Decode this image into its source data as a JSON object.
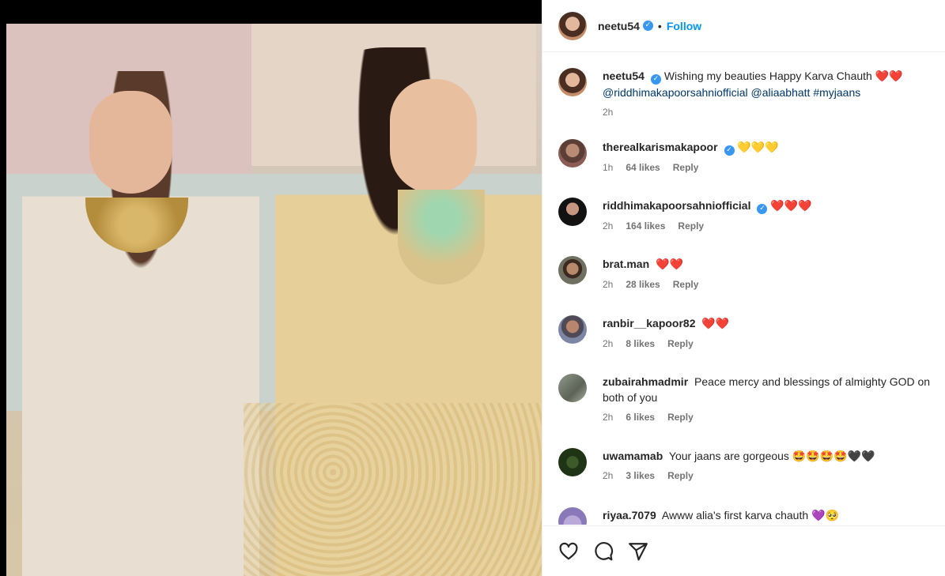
{
  "post_author": {
    "username": "neetu54",
    "verified": true,
    "separator": "•",
    "follow_label": "Follow"
  },
  "caption": {
    "username": "neetu54",
    "text": "Wishing my beauties Happy Karva Chauth",
    "emoji": "❤️❤️",
    "mentions": "@riddhimakapoorsahniofficial @aliaabhatt #myjaans",
    "time": "2h"
  },
  "comments": [
    {
      "username": "therealkarismakapoor",
      "verified": true,
      "text": "",
      "emoji": "💛💛💛",
      "time": "1h",
      "likes": "64 likes",
      "reply": "Reply"
    },
    {
      "username": "riddhimakapoorsahniofficial",
      "verified": true,
      "text": "",
      "emoji": "❤️❤️❤️",
      "time": "2h",
      "likes": "164 likes",
      "reply": "Reply"
    },
    {
      "username": "brat.man",
      "verified": false,
      "text": "",
      "emoji": "❤️❤️",
      "time": "2h",
      "likes": "28 likes",
      "reply": "Reply"
    },
    {
      "username": "ranbir__kapoor82",
      "verified": false,
      "text": "",
      "emoji": "❤️❤️",
      "time": "2h",
      "likes": "8 likes",
      "reply": "Reply"
    },
    {
      "username": "zubairahmadmir",
      "verified": false,
      "text": "Peace mercy and blessings of almighty GOD on both of you",
      "emoji": "",
      "time": "2h",
      "likes": "6 likes",
      "reply": "Reply"
    },
    {
      "username": "uwamamab",
      "verified": false,
      "text": "Your jaans are gorgeous",
      "emoji": "🤩🤩🤩🤩🖤🖤",
      "time": "2h",
      "likes": "3 likes",
      "reply": "Reply"
    },
    {
      "username": "riyaa.7079",
      "verified": false,
      "text": "Awww alia's first karva chauth",
      "emoji": "💜🥺",
      "time": "",
      "likes": "",
      "reply": ""
    }
  ],
  "actions": {
    "like_icon": "heart-icon",
    "comment_icon": "comment-icon",
    "share_icon": "share-icon"
  },
  "colors": {
    "accent": "#0095f6",
    "verified": "#3897f0",
    "mention": "#00376b",
    "meta": "#737373"
  }
}
